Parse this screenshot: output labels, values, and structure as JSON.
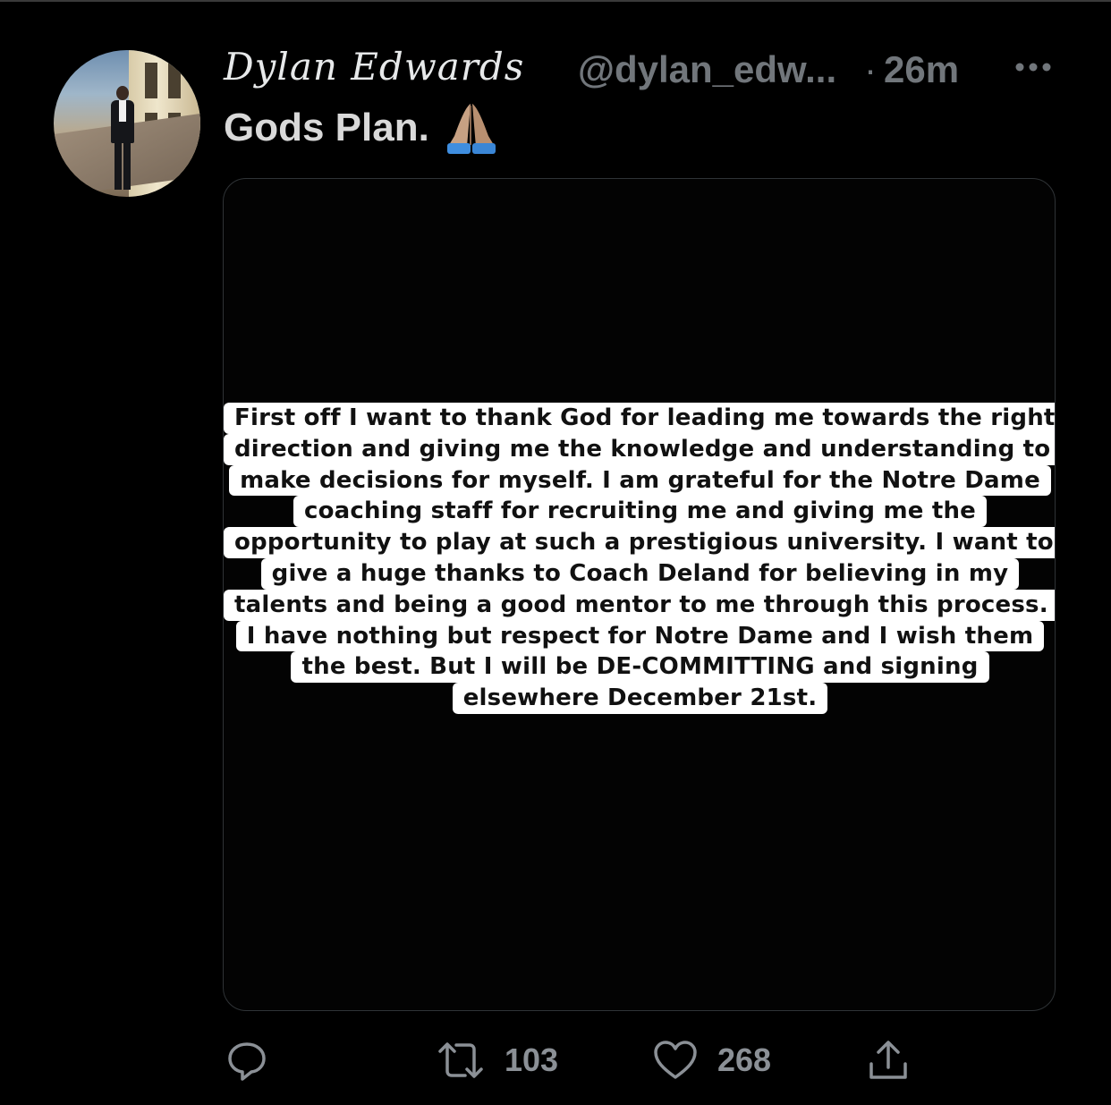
{
  "tweet": {
    "author_name": "Dylan Edwards",
    "handle": "@dylan_edw...",
    "separator": "·",
    "time": "26m",
    "text": "Gods Plan.",
    "emoji": "folded-hands",
    "media": {
      "story_lines": [
        "First off I want to thank God for leading me towards the right",
        "direction and giving me the knowledge and understanding to",
        "make decisions for myself. I am grateful for the Notre Dame",
        "coaching staff for recruiting me and giving me the",
        "opportunity to play at such a prestigious university. I want to",
        "give a huge thanks to Coach Deland for believing in my",
        "talents and being a good mentor to me through this process.",
        "I have nothing but respect for Notre Dame and I wish them",
        "the best. But I will be DE-COMMITTING and signing",
        "elsewhere December 21st."
      ]
    }
  },
  "actions": {
    "reply": {
      "icon": "reply-icon",
      "count": ""
    },
    "retweet": {
      "icon": "retweet-icon",
      "count": "103"
    },
    "like": {
      "icon": "heart-icon",
      "count": "268"
    },
    "share": {
      "icon": "share-icon"
    }
  },
  "colors": {
    "background": "#000000",
    "text_primary": "#e7e9ea",
    "text_secondary": "#71767b",
    "media_border": "#2f3336"
  }
}
